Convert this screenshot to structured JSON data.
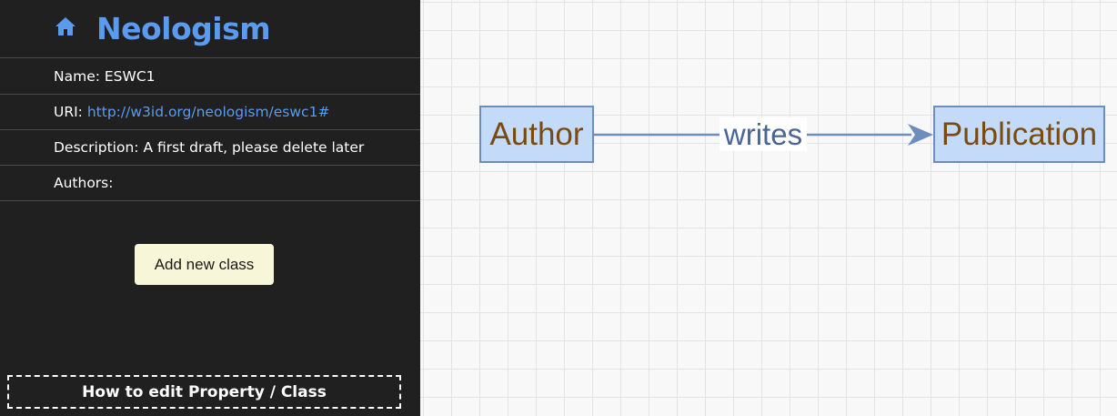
{
  "sidebar": {
    "brand": {
      "title": "Neologism",
      "icon": "home-icon"
    },
    "info": {
      "name_label": "Name:",
      "name_value": "ESWC1",
      "uri_label": "URI:",
      "uri_value": "http://w3id.org/neologism/eswc1#",
      "description_label": "Description:",
      "description_value": "A first draft, please delete later",
      "authors_label": "Authors:"
    },
    "add_class_label": "Add new class",
    "help_label": "How to edit Property / Class"
  },
  "diagram": {
    "nodes": [
      {
        "label": "Author"
      },
      {
        "label": "Publication"
      }
    ],
    "edge": {
      "label": "writes",
      "from": "Author",
      "to": "Publication"
    },
    "colors": {
      "node_fill": "#c3daf9",
      "node_border": "#6c8ebf",
      "node_text": "#7a4a10",
      "edge": "#6c8ebf",
      "edge_label_text": "#4a6496",
      "accent": "#5b9bef"
    }
  }
}
